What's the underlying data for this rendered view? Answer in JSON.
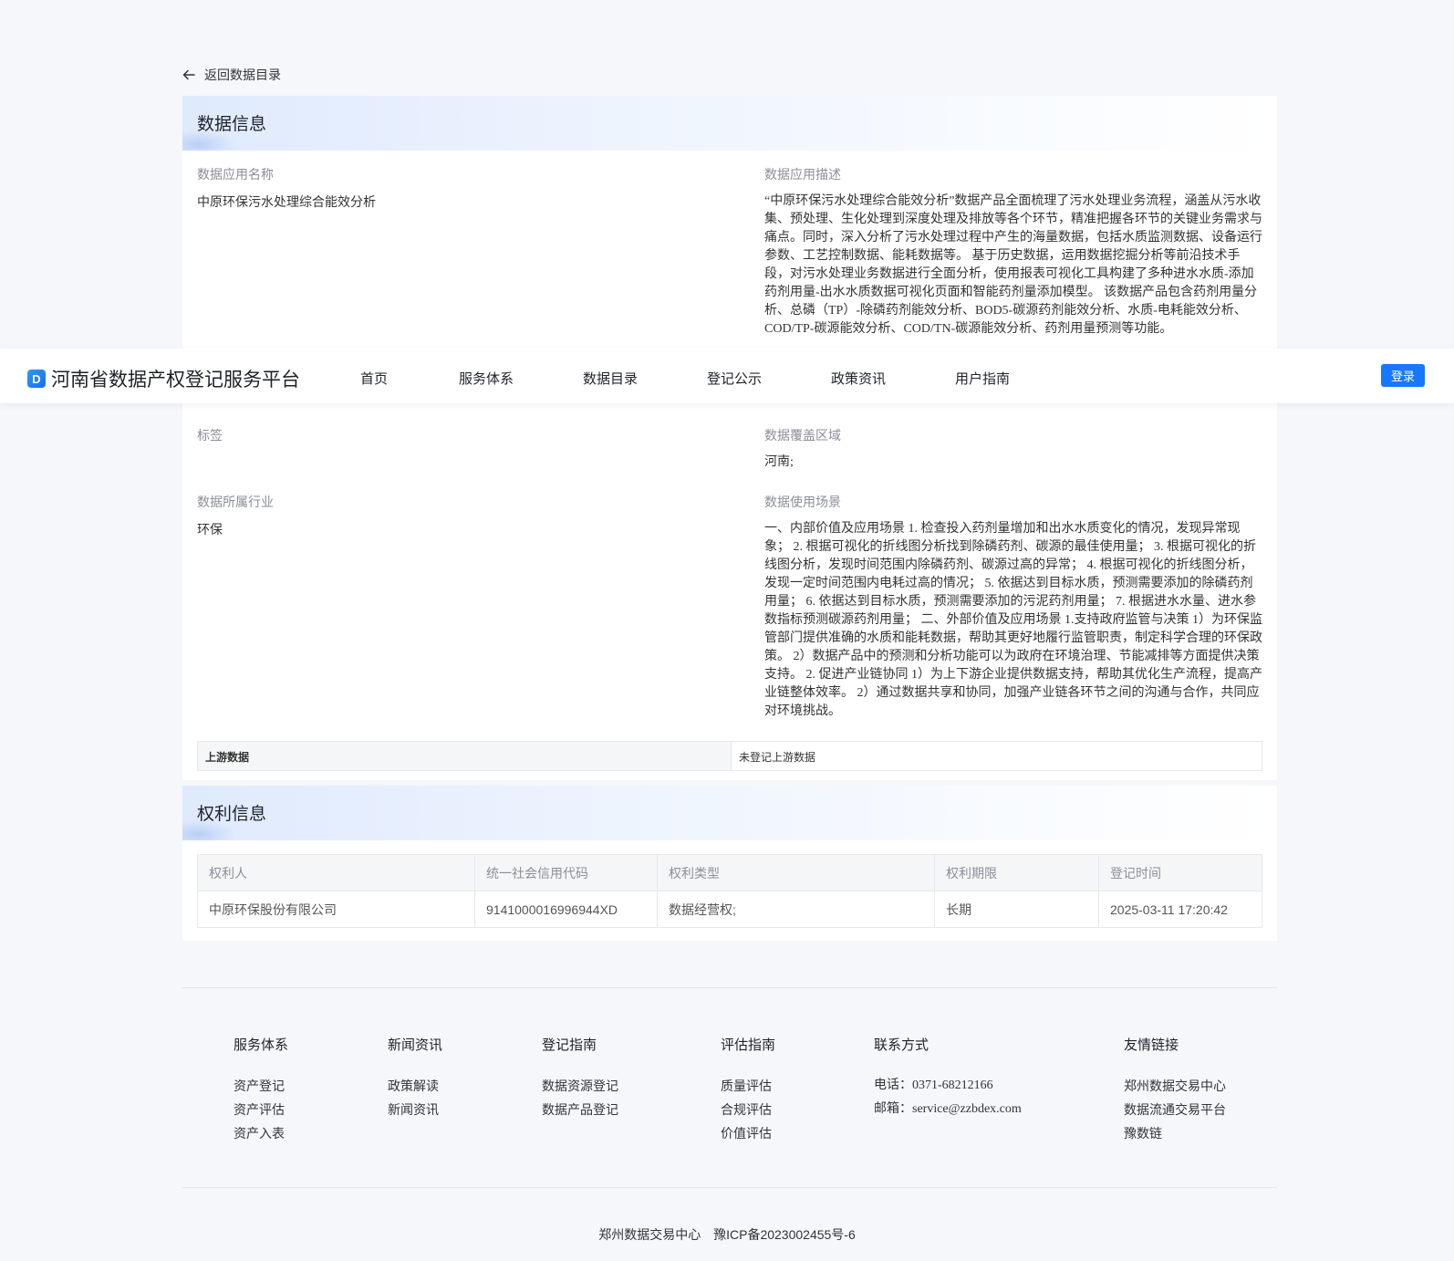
{
  "back_link": "返回数据目录",
  "data_info": {
    "title": "数据信息",
    "app_name_label": "数据应用名称",
    "app_name": "中原环保污水处理综合能效分析",
    "desc_label": "数据应用描述",
    "desc": "“中原环保污水处理综合能效分析”数据产品全面梳理了污水处理业务流程，涵盖从污水收集、预处理、生化处理到深度处理及排放等各个环节，精准把握各环节的关键业务需求与痛点。同时，深入分析了污水处理过程中产生的海量数据，包括水质监测数据、设备运行参数、工艺控制数据、能耗数据等。 基于历史数据，运用数据挖掘分析等前沿技术手段，对污水处理业务数据进行全面分析，使用报表可视化工具构建了多种进水水质-添加药剂用量-出水水质数据可视化页面和智能药剂量添加模型。 该数据产品包含药剂用量分析、总磷（TP）-除磷药剂能效分析、BOD5-碳源药剂能效分析、水质-电耗能效分析、COD/TP-碳源能效分析、COD/TN-碳源能效分析、药剂用量预测等功能。",
    "tags_label": "标签",
    "coverage_label": "数据覆盖区域",
    "coverage": "河南;",
    "industry_label": "数据所属行业",
    "industry": "环保",
    "scenario_label": "数据使用场景",
    "scenario": "一、内部价值及应用场景 1. 检查投入药剂量增加和出水水质变化的情况，发现异常现象； 2. 根据可视化的折线图分析找到除磷药剂、碳源的最佳使用量； 3. 根据可视化的折线图分析，发现时间范围内除磷药剂、碳源过高的异常； 4. 根据可视化的折线图分析，发现一定时间范围内电耗过高的情况； 5. 依据达到目标水质，预测需要添加的除磷药剂用量； 6. 依据达到目标水质，预测需要添加的污泥药剂用量； 7. 根据进水水量、进水参数指标预测碳源药剂用量； 二、外部价值及应用场景 1.支持政府监管与决策 1）为环保监管部门提供准确的水质和能耗数据，帮助其更好地履行监管职责，制定科学合理的环保政策。 2）数据产品中的预测和分析功能可以为政府在环境治理、节能减排等方面提供决策支持。 2. 促进产业链协同 1）为上下游企业提供数据支持，帮助其优化生产流程，提高产业链整体效率。 2）通过数据共享和协同，加强产业链各环节之间的沟通与合作，共同应对环境挑战。",
    "upstream_label": "上游数据",
    "upstream_value": "未登记上游数据"
  },
  "nav": {
    "logo_mark": "D",
    "logo_text": "河南省数据产权登记服务平台",
    "items": [
      "首页",
      "服务体系",
      "数据目录",
      "登记公示",
      "政策资讯",
      "用户指南"
    ],
    "login": "登录"
  },
  "rights": {
    "title": "权利信息",
    "headers": [
      "权利人",
      "统一社会信用代码",
      "权利类型",
      "权利期限",
      "登记时间"
    ],
    "row": [
      "中原环保股份有限公司",
      "9141000016996944XD",
      "数据经营权;",
      "长期",
      "2025-03-11 17:20:42"
    ]
  },
  "footer": {
    "cols": [
      {
        "title": "服务体系",
        "items": [
          "资产登记",
          "资产评估",
          "资产入表"
        ]
      },
      {
        "title": "新闻资讯",
        "items": [
          "政策解读",
          "新闻资讯"
        ]
      },
      {
        "title": "登记指南",
        "items": [
          "数据资源登记",
          "数据产品登记"
        ]
      },
      {
        "title": "评估指南",
        "items": [
          "质量评估",
          "合规评估",
          "价值评估"
        ]
      },
      {
        "title": "联系方式",
        "items": [
          "电话：0371-68212166",
          "邮箱：service@zzbdex.com"
        ]
      },
      {
        "title": "友情链接",
        "items": [
          "郑州数据交易中心",
          "数据流通交易平台",
          "豫数链"
        ]
      }
    ],
    "org": "郑州数据交易中心",
    "icp": "豫ICP备2023002455号-6"
  }
}
